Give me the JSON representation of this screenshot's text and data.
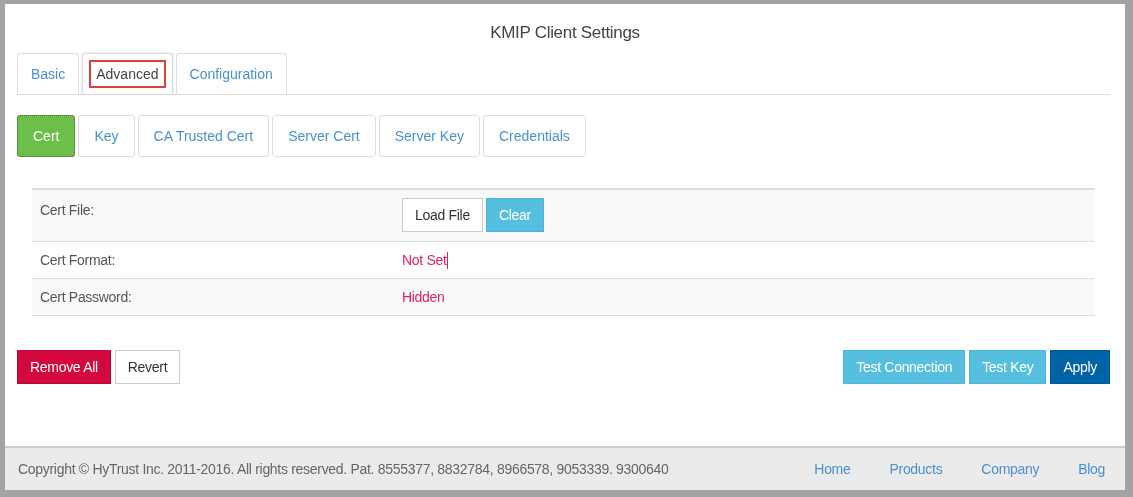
{
  "window": {
    "title": "KMIP Client Settings"
  },
  "tabs": [
    {
      "label": "Basic",
      "selected": false,
      "highlighted": false
    },
    {
      "label": "Advanced",
      "selected": true,
      "highlighted": true
    },
    {
      "label": "Configuration",
      "selected": false,
      "highlighted": false
    }
  ],
  "subtabs": [
    {
      "label": "Cert",
      "selected": true
    },
    {
      "label": "Key",
      "selected": false
    },
    {
      "label": "CA Trusted Cert",
      "selected": false
    },
    {
      "label": "Server Cert",
      "selected": false
    },
    {
      "label": "Server Key",
      "selected": false
    },
    {
      "label": "Credentials",
      "selected": false
    }
  ],
  "fields": [
    {
      "kind": "buttons",
      "label": "Cert File:",
      "buttons": [
        {
          "label": "Load File",
          "kind": "default"
        },
        {
          "label": "Clear",
          "kind": "info"
        }
      ]
    },
    {
      "kind": "value",
      "label": "Cert Format:",
      "value": "Not Set",
      "caret": true
    },
    {
      "kind": "value",
      "label": "Cert Password:",
      "value": "Hidden",
      "caret": false
    }
  ],
  "actions_left": [
    {
      "label": "Remove All",
      "kind": "danger"
    },
    {
      "label": "Revert",
      "kind": "default"
    }
  ],
  "actions_right": [
    {
      "label": "Test Connection",
      "kind": "info"
    },
    {
      "label": "Test Key",
      "kind": "info"
    },
    {
      "label": "Apply",
      "kind": "primary"
    }
  ],
  "footer": {
    "copyright": "Copyright © HyTrust Inc. 2011-2016. All rights reserved. Pat. 8555377, 8832784, 8966578, 9053339. 9300640",
    "links": [
      "Home",
      "Products",
      "Company",
      "Blog"
    ]
  }
}
